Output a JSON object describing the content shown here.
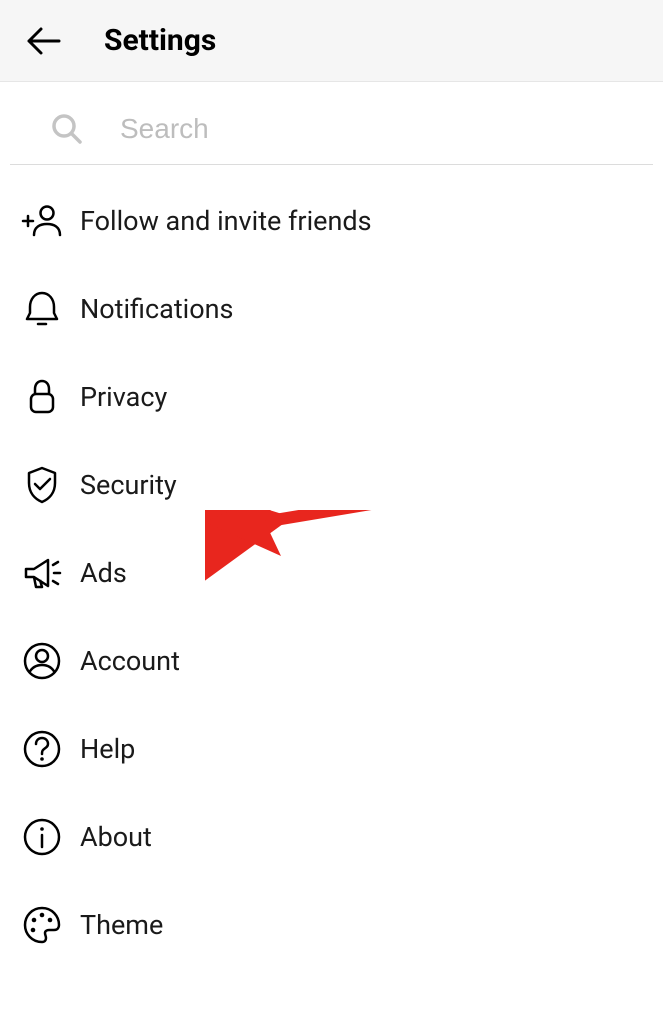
{
  "header": {
    "title": "Settings"
  },
  "search": {
    "placeholder": "Search"
  },
  "menu": {
    "items": [
      {
        "label": "Follow and invite friends",
        "icon": "add-person"
      },
      {
        "label": "Notifications",
        "icon": "bell"
      },
      {
        "label": "Privacy",
        "icon": "lock"
      },
      {
        "label": "Security",
        "icon": "shield-check"
      },
      {
        "label": "Ads",
        "icon": "megaphone"
      },
      {
        "label": "Account",
        "icon": "person-circle"
      },
      {
        "label": "Help",
        "icon": "question-circle"
      },
      {
        "label": "About",
        "icon": "info-circle"
      },
      {
        "label": "Theme",
        "icon": "palette"
      }
    ]
  }
}
